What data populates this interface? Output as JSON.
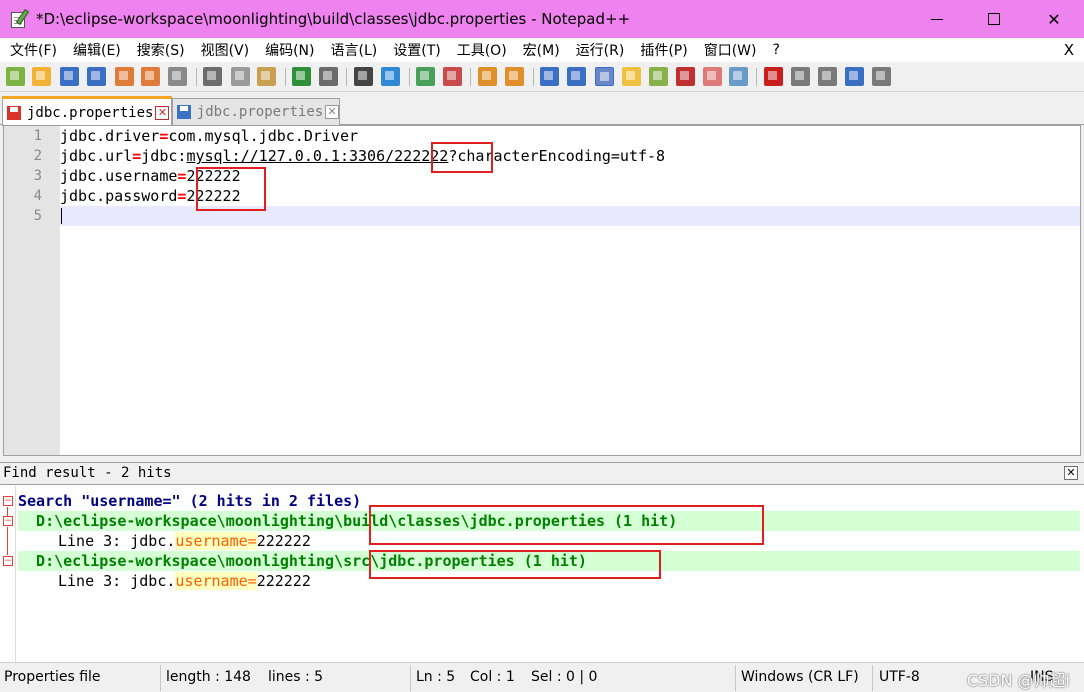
{
  "window": {
    "title": "*D:\\eclipse-workspace\\moonlighting\\build\\classes\\jdbc.properties - Notepad++",
    "min_label": "",
    "max_label": "",
    "close_label": "✕"
  },
  "menu": {
    "items": [
      "文件(F)",
      "编辑(E)",
      "搜索(S)",
      "视图(V)",
      "编码(N)",
      "语言(L)",
      "设置(T)",
      "工具(O)",
      "宏(M)",
      "运行(R)",
      "插件(P)",
      "窗口(W)",
      "?"
    ],
    "close_label": "X"
  },
  "toolbar": {
    "icons": [
      "new-file-icon",
      "open-file-icon",
      "save-icon",
      "save-all-icon",
      "close-icon",
      "close-all-icon",
      "print-icon",
      "cut-icon",
      "copy-icon",
      "paste-icon",
      "undo-icon",
      "redo-icon",
      "find-icon",
      "replace-icon",
      "zoom-in-icon",
      "zoom-out-icon",
      "sync-vertical-icon",
      "sync-horizontal-icon",
      "word-wrap-icon",
      "show-all-chars-icon",
      "indent-guide-icon",
      "udl-icon",
      "doc-map-icon",
      "function-list-icon",
      "folder-workspace-icon",
      "monitoring-icon",
      "record-macro-icon",
      "stop-record-icon",
      "play-macro-icon",
      "run-macro-multiple-icon",
      "save-macro-icon"
    ]
  },
  "tabs": [
    {
      "label": "jdbc.properties",
      "active": true
    },
    {
      "label": "jdbc.properties",
      "active": false
    }
  ],
  "tab_close_glyph": "✕",
  "editor": {
    "line_numbers": [
      "1",
      "2",
      "3",
      "4",
      "5"
    ],
    "lines": {
      "l1_key": "jdbc.driver",
      "l1_eq": "=",
      "l1_val": "com.mysql.jdbc.Driver",
      "l2_key": "jdbc.url",
      "l2_eq": "=",
      "l2_pre": "jdbc:",
      "l2_link": "mysql://127.0.0.1:3306/222222",
      "l2_post": "?characterEncoding=utf-8",
      "l3_key": "jdbc.username",
      "l3_eq": "=",
      "l3_val": "222222",
      "l4_key": "jdbc.password",
      "l4_eq": "=",
      "l4_val": "222222"
    }
  },
  "find_results": {
    "title": "Find result - 2 hits",
    "close_glyph": "✕",
    "search_line": "Search \"username=\" (2 hits in 2 files)",
    "files": [
      {
        "path": "  D:\\eclipse-workspace\\moonlighting\\build\\classes\\jdbc.properties (1 hit)",
        "hit_prefix": "Line 3: jdbc.",
        "hit_match": "username=",
        "hit_suffix": "222222"
      },
      {
        "path": "  D:\\eclipse-workspace\\moonlighting\\src\\jdbc.properties (1 hit)",
        "hit_prefix": "Line 3: jdbc.",
        "hit_match": "username=",
        "hit_suffix": "222222"
      }
    ],
    "fold_glyph": "−"
  },
  "statusbar": {
    "file_type": "Properties file",
    "length": "length : 148",
    "lines": "lines : 5",
    "ln": "Ln : 5",
    "col": "Col : 1",
    "sel": "Sel : 0 | 0",
    "eol": "Windows (CR LF)",
    "encoding": "UTF-8",
    "mode": "INS",
    "watermark": "CSDN @帅超i"
  }
}
